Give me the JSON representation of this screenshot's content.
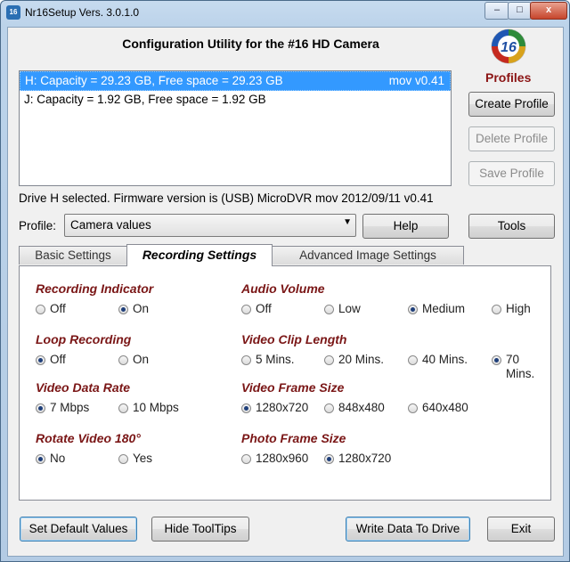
{
  "window": {
    "title": "Nr16Setup  Vers. 3.0.1.0",
    "app_icon_text": "16",
    "minimize": "–",
    "maximize": "□",
    "close": "x"
  },
  "header": {
    "title": "Configuration Utility for the #16 HD Camera",
    "logo_text": "16",
    "profiles_label": "Profiles"
  },
  "drives": [
    {
      "label": "H:  Capacity = 29.23 GB, Free space = 29.23 GB",
      "version": "mov v0.41",
      "selected": true
    },
    {
      "label": "J:  Capacity = 1.92 GB, Free space = 1.92 GB",
      "version": "",
      "selected": false
    }
  ],
  "profile_buttons": {
    "create": "Create Profile",
    "delete": "Delete Profile",
    "save": "Save Profile"
  },
  "status_text": "Drive H selected. Firmware version is (USB) MicroDVR mov 2012/09/11 v0.41",
  "profile": {
    "label": "Profile:",
    "value": "Camera values",
    "help": "Help",
    "tools": "Tools"
  },
  "tabs": {
    "basic": "Basic Settings",
    "recording": "Recording Settings",
    "advanced": "Advanced Image Settings"
  },
  "groups": {
    "recording_indicator": {
      "title": "Recording Indicator",
      "options": [
        "Off",
        "On"
      ],
      "selected": 1
    },
    "audio_volume": {
      "title": "Audio Volume",
      "options": [
        "Off",
        "Low",
        "Medium",
        "High"
      ],
      "selected": 2
    },
    "loop_recording": {
      "title": "Loop Recording",
      "options": [
        "Off",
        "On"
      ],
      "selected": 0
    },
    "video_clip_length": {
      "title": "Video Clip Length",
      "options": [
        "5 Mins.",
        "20 Mins.",
        "40 Mins.",
        "70 Mins."
      ],
      "selected": 3
    },
    "video_data_rate": {
      "title": "Video Data Rate",
      "options": [
        "7 Mbps",
        "10 Mbps"
      ],
      "selected": 0
    },
    "video_frame_size": {
      "title": "Video Frame Size",
      "options": [
        "1280x720",
        "848x480",
        "640x480"
      ],
      "selected": 0
    },
    "rotate_video": {
      "title": "Rotate Video 180°",
      "options": [
        "No",
        "Yes"
      ],
      "selected": 0
    },
    "photo_frame_size": {
      "title": "Photo Frame Size",
      "options": [
        "1280x960",
        "1280x720"
      ],
      "selected": 1
    }
  },
  "footer": {
    "set_default": "Set Default Values",
    "hide_tooltips": "Hide ToolTips",
    "write_data": "Write Data To Drive",
    "exit": "Exit"
  }
}
